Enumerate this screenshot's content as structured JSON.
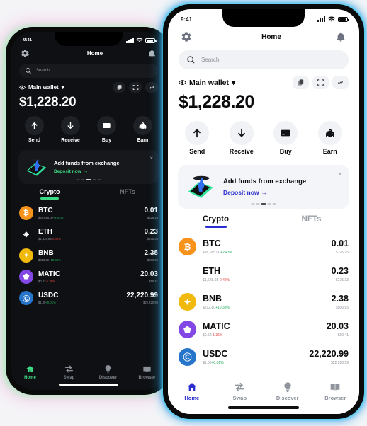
{
  "statusbar": {
    "time": "9:41"
  },
  "header": {
    "title": "Home",
    "settings_icon": "gear-icon",
    "bell_icon": "bell-icon"
  },
  "search": {
    "placeholder": "Search",
    "icon": "search-icon"
  },
  "wallet": {
    "name": "Main wallet",
    "eye_icon": "eye-icon",
    "chevron": "▾",
    "balance": "$1,228.20",
    "actions": [
      {
        "name": "copy-address-button",
        "icon": "copy-icon"
      },
      {
        "name": "scan-qr-button",
        "icon": "scan-icon"
      },
      {
        "name": "connect-button",
        "icon": "link-icon"
      }
    ]
  },
  "quick_actions": [
    {
      "label": "Send",
      "icon": "arrow-up-icon"
    },
    {
      "label": "Receive",
      "icon": "arrow-down-icon"
    },
    {
      "label": "Buy",
      "icon": "credit-card-icon"
    },
    {
      "label": "Earn",
      "icon": "piggy-bank-icon"
    }
  ],
  "promo": {
    "title": "Add funds from exchange",
    "link": "Deposit now",
    "arrow": "→",
    "close": "×",
    "dots": 5,
    "active_dot": 2
  },
  "tabs": [
    {
      "label": "Crypto",
      "active": true
    },
    {
      "label": "NFTs",
      "active": false
    }
  ],
  "tokens": [
    {
      "symbol": "BTC",
      "price": "$26,685.00",
      "change": "+2.43%",
      "dir": "up",
      "amount": "0.01",
      "usd": "$226.25",
      "color": "#f7931a",
      "glyph": "₿"
    },
    {
      "symbol": "ETH",
      "price": "$1,628.65",
      "change": "-0.42%",
      "dir": "down",
      "amount": "0.23",
      "usd": "$375.33",
      "color": "#6ب7fd7",
      "glyph": "◈"
    },
    {
      "symbol": "BNB",
      "price": "$212.80",
      "change": "+10.38%",
      "dir": "up",
      "amount": "2.38",
      "usd": "$506.95",
      "color": "#f0b90b",
      "glyph": "✦"
    },
    {
      "symbol": "MATIC",
      "price": "$0.52",
      "change": "-1.36%",
      "dir": "down",
      "amount": "20.03",
      "usd": "$10.41",
      "color": "#8247e5",
      "glyph": "⬟"
    },
    {
      "symbol": "USDC",
      "price": "$1.00",
      "change": "+0.01%",
      "dir": "up",
      "amount": "22,220.99",
      "usd": "$22,220.99",
      "color": "#2775ca",
      "glyph": "Ⓒ"
    }
  ],
  "nav": [
    {
      "label": "Home",
      "icon": "home-icon",
      "active": true
    },
    {
      "label": "Swap",
      "icon": "swap-icon",
      "active": false
    },
    {
      "label": "Discover",
      "icon": "bulb-icon",
      "active": false
    },
    {
      "label": "Browser",
      "icon": "browser-icon",
      "active": false
    }
  ],
  "theme": {
    "dark_accent": "#3ddc84",
    "light_accent": "#2a2ecf",
    "up_color": "#1fae5a",
    "down_color": "#e0453e"
  }
}
